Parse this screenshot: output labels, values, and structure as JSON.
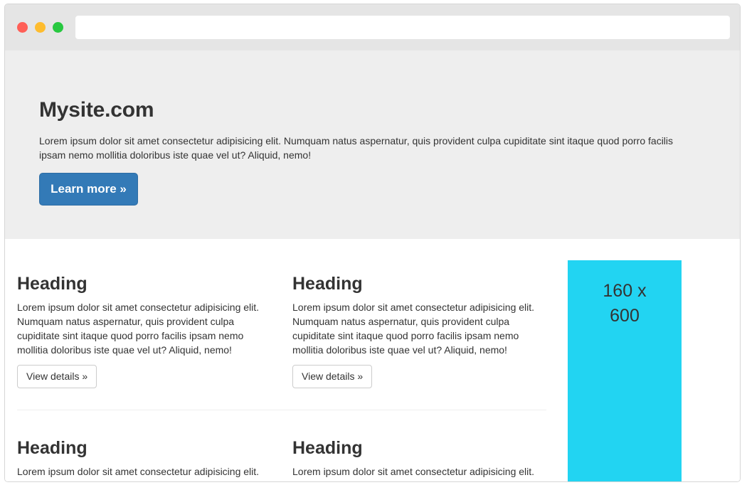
{
  "window": {
    "traffic_lights": {
      "close_color": "#ff5f57",
      "minimize_color": "#febc2e",
      "maximize_color": "#28c840"
    },
    "address_bar": {
      "value": ""
    }
  },
  "jumbotron": {
    "title": "Mysite.com",
    "text": "Lorem ipsum dolor sit amet consectetur adipisicing elit. Numquam natus aspernatur, quis provident culpa cupiditate sint itaque quod porro facilis ipsam nemo mollitia doloribus iste quae vel ut? Aliquid, nemo!",
    "button_label": "Learn more »"
  },
  "cards": [
    {
      "heading": "Heading",
      "text": "Lorem ipsum dolor sit amet consectetur adipisicing elit. Numquam natus aspernatur, quis provident culpa cupiditate sint itaque quod porro facilis ipsam nemo mollitia doloribus iste quae vel ut? Aliquid, nemo!",
      "button_label": "View details »"
    },
    {
      "heading": "Heading",
      "text": "Lorem ipsum dolor sit amet consectetur adipisicing elit. Numquam natus aspernatur, quis provident culpa cupiditate sint itaque quod porro facilis ipsam nemo mollitia doloribus iste quae vel ut? Aliquid, nemo!",
      "button_label": "View details »"
    },
    {
      "heading": "Heading",
      "text": "Lorem ipsum dolor sit amet consectetur adipisicing elit."
    },
    {
      "heading": "Heading",
      "text": "Lorem ipsum dolor sit amet consectetur adipisicing elit."
    }
  ],
  "ad": {
    "line1": "160 x",
    "line2": "600",
    "color": "#22d4f2"
  },
  "colors": {
    "primary": "#337ab7",
    "jumbotron_bg": "#eeeeee",
    "titlebar_bg": "#e5e5e5"
  }
}
